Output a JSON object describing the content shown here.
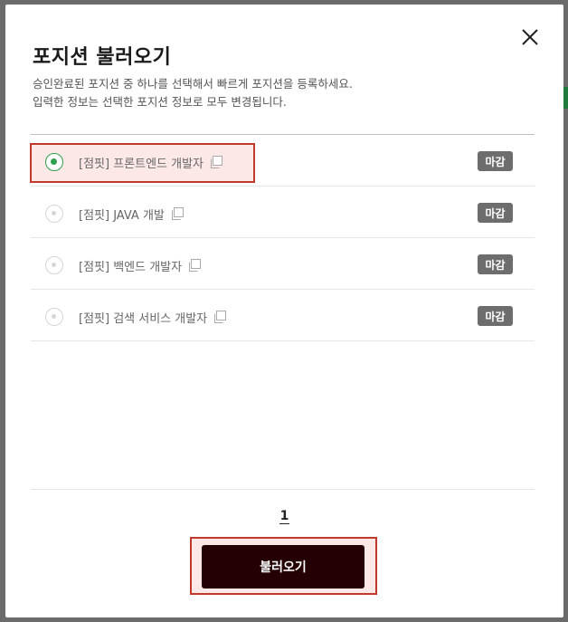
{
  "modal": {
    "title": "포지션 불러오기",
    "description_line1": "승인완료된 포지션 중 하나를 선택해서 빠르게 포지션을 등록하세요.",
    "description_line2": "입력한 정보는 선택한 포지션 정보로 모두 변경됩니다."
  },
  "positions": [
    {
      "label": "[점핏] 프론트엔드 개발자",
      "status": "마감",
      "selected": true
    },
    {
      "label": "[점핏] JAVA 개발",
      "status": "마감",
      "selected": false
    },
    {
      "label": "[점핏] 백엔드 개발자",
      "status": "마감",
      "selected": false
    },
    {
      "label": "[점핏] 검색 서비스 개발자",
      "status": "마감",
      "selected": false
    }
  ],
  "pagination": {
    "current": "1"
  },
  "actions": {
    "load_label": "불러오기"
  },
  "colors": {
    "accent_green": "#2e9e4f",
    "button_bg": "#240005",
    "badge_bg": "#6d6d6d",
    "highlight": "#c0392b"
  },
  "icons": {
    "close": "close-icon",
    "copy": "copy-icon",
    "radio": "radio-icon"
  }
}
